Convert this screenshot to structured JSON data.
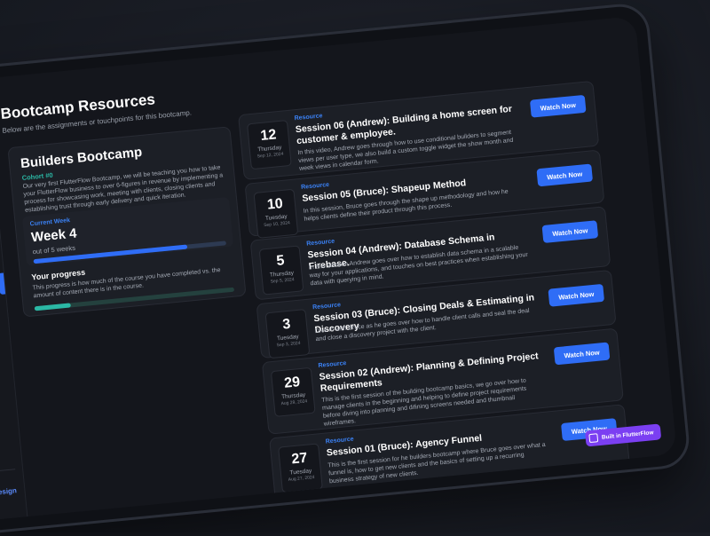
{
  "page": {
    "title": "Bootcamp Resources",
    "subtitle": "Below are the assignments or touchpoints for this bootcamp.",
    "sidebar_footer": "ees.design"
  },
  "bootcamp": {
    "title": "Builders Bootcamp",
    "cohort": "Cohort #0",
    "description": "Our very first FlutterFlow Bootcamp, we will be teaching you how to take your FlutterFlow business to over 6-figures in revenue by implementing a process for showcasing work, meeting with clients, closing clients and establishing trust through early delivery and quick iteration.",
    "week_label": "Current Week",
    "week_value": "Week 4",
    "week_of": "out of 5 weeks",
    "week_progress": 0.8,
    "progress_title": "Your progress",
    "progress_desc": "This progress is how much of the course you have completed vs. the amount of content there is in the course.",
    "course_progress": 0.18
  },
  "sessions": [
    {
      "tag": "Resource",
      "title": "Session 06 (Andrew): Building a home screen for customer & employee.",
      "description": "In this video, Andrew goes through how to use conditional builders to segment views per user type, we also build a custom toggle widget the show month and week views in calendar form.",
      "day": "12",
      "weekday": "Thursday",
      "date": "Sep 12, 2024",
      "button": "Watch Now"
    },
    {
      "tag": "Resource",
      "title": "Session 05 (Bruce): Shapeup Method",
      "description": "In this session, Bruce goes through the shape up methodology and how he helps clients define their product through this process.",
      "day": "10",
      "weekday": "Tuesday",
      "date": "Sep 10, 2024",
      "button": "Watch Now"
    },
    {
      "tag": "Resource",
      "title": "Session 04 (Andrew): Database Schema in Firebase.",
      "description": "In this session Andrew goes over how to establish data schema in a scalable way for your applications, and touches on best practices when establishing your data with querying in mind.",
      "day": "5",
      "weekday": "Thursday",
      "date": "Sep 5, 2024",
      "button": "Watch Now"
    },
    {
      "tag": "Resource",
      "title": "Session 03 (Bruce): Closing Deals & Estimating in Discovery",
      "description": "Dive in with Bruce as he goes over how to handle client calls and seal the deal and close a discovery project with the client.",
      "day": "3",
      "weekday": "Tuesday",
      "date": "Sep 3, 2024",
      "button": "Watch Now"
    },
    {
      "tag": "Resource",
      "title": "Session 02 (Andrew): Planning & Defining Project Requirements",
      "description": "This is the first session of the building bootcamp basics, we go over how to manage clients in the beginning and helping to define project requirements before diving into planning and difining screens needed and thumbnail wireframes.",
      "day": "29",
      "weekday": "Thursday",
      "date": "Aug 29, 2024",
      "button": "Watch Now"
    },
    {
      "tag": "Resource",
      "title": "Session 01 (Bruce): Agency Funnel",
      "description": "This is the first session for he builders bootcamp where Bruce goes over what a funnel is, how to get new clients and the basics of setting up a recurring business strategy of new clients.",
      "day": "27",
      "weekday": "Tuesday",
      "date": "Aug 27, 2024",
      "button": "Watch Now"
    }
  ],
  "badge": {
    "label": "Built in FlutterFlow"
  },
  "colors": {
    "accent": "#2f6df6",
    "teal": "#2bb8a5",
    "badge": "#7b3ff2"
  }
}
